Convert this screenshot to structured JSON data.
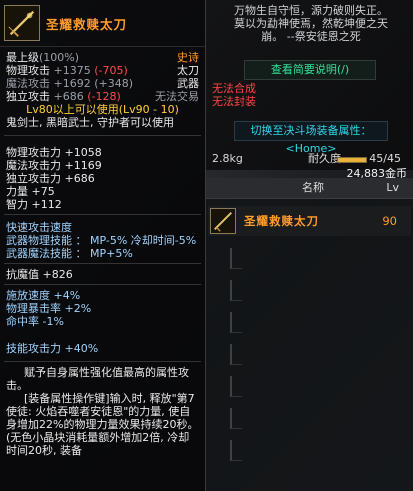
{
  "tooltip": {
    "title": "圣耀救赎太刀",
    "level_text": "最上级",
    "level_pct": "(100%)",
    "rarity": "史诗",
    "phys_attack": {
      "label": "物理攻击",
      "value": "+1375",
      "diff": "(-705)",
      "type": "太刀"
    },
    "mag_attack": {
      "label": "魔法攻击",
      "value": "+1692",
      "diff": "(+348)",
      "type": "武器"
    },
    "ind_attack": {
      "label": "独立攻击",
      "value": "+686",
      "diff": "(-128)",
      "trade": "无法交易"
    },
    "req_level": "Lv80以上可以使用(Lv90 - 10)",
    "classes": "鬼剑士, 黑暗武士, 守护者可以使用",
    "stats": [
      {
        "label": "物理攻击力",
        "value": "+1058"
      },
      {
        "label": "魔法攻击力",
        "value": "+1169"
      },
      {
        "label": "独立攻击力",
        "value": "+686"
      },
      {
        "label": "力量",
        "value": "+75"
      },
      {
        "label": "智力",
        "value": "+112"
      }
    ],
    "speed_title": "快速攻击速度",
    "skill_phys": "武器物理技能 ： MP-5% 冷却时间-5%",
    "skill_mag": "武器魔法技能 ： MP+5%",
    "resist": "抗魔值 +826",
    "bonus": [
      "施放速度 +4%",
      "物理暴击率 +2%",
      "命中率 -1%"
    ],
    "skill_atk": "技能攻击力 +40%",
    "desc1": "赋予自身属性强化值最高的属性攻击。",
    "desc2": "[装备属性操作键]输入时, 释放\"第7使徒: 火焰吞噬者安徒恩\"的力量, 使自身增加22%的物理力量效果持续20秒。(无色小晶块消耗量额外增加2倍, 冷却时间20秒, 装备"
  },
  "right": {
    "poem": [
      "万物生自守恒，源力破则失正。",
      "莫以为勐神使焉，然乾坤便之天",
      "崩。 --祭安徒恩之死"
    ],
    "view_button": "查看简要说明(/)",
    "no_combine": "无法合成",
    "no_seal": "无法封装",
    "switch_button": "切换至决斗场装备属性：<Home>",
    "weight": "2.8kg",
    "durability_label": "耐久度",
    "durability_value": "45/45",
    "durability_fraction": 1.0,
    "gold": "24,883金币",
    "table": {
      "col_name": "名称",
      "col_lv": "Lv",
      "rows": [
        {
          "name": "圣耀救赎太刀",
          "lv": "90"
        }
      ]
    }
  },
  "colors": {
    "epic": "#ff9c2a",
    "red": "#ff4a4a",
    "green_btn": "#34e09b",
    "cyan_btn": "#2dd8e8"
  },
  "icons": {
    "item_icon": "katana-icon",
    "table_item_icon": "katana-icon"
  }
}
